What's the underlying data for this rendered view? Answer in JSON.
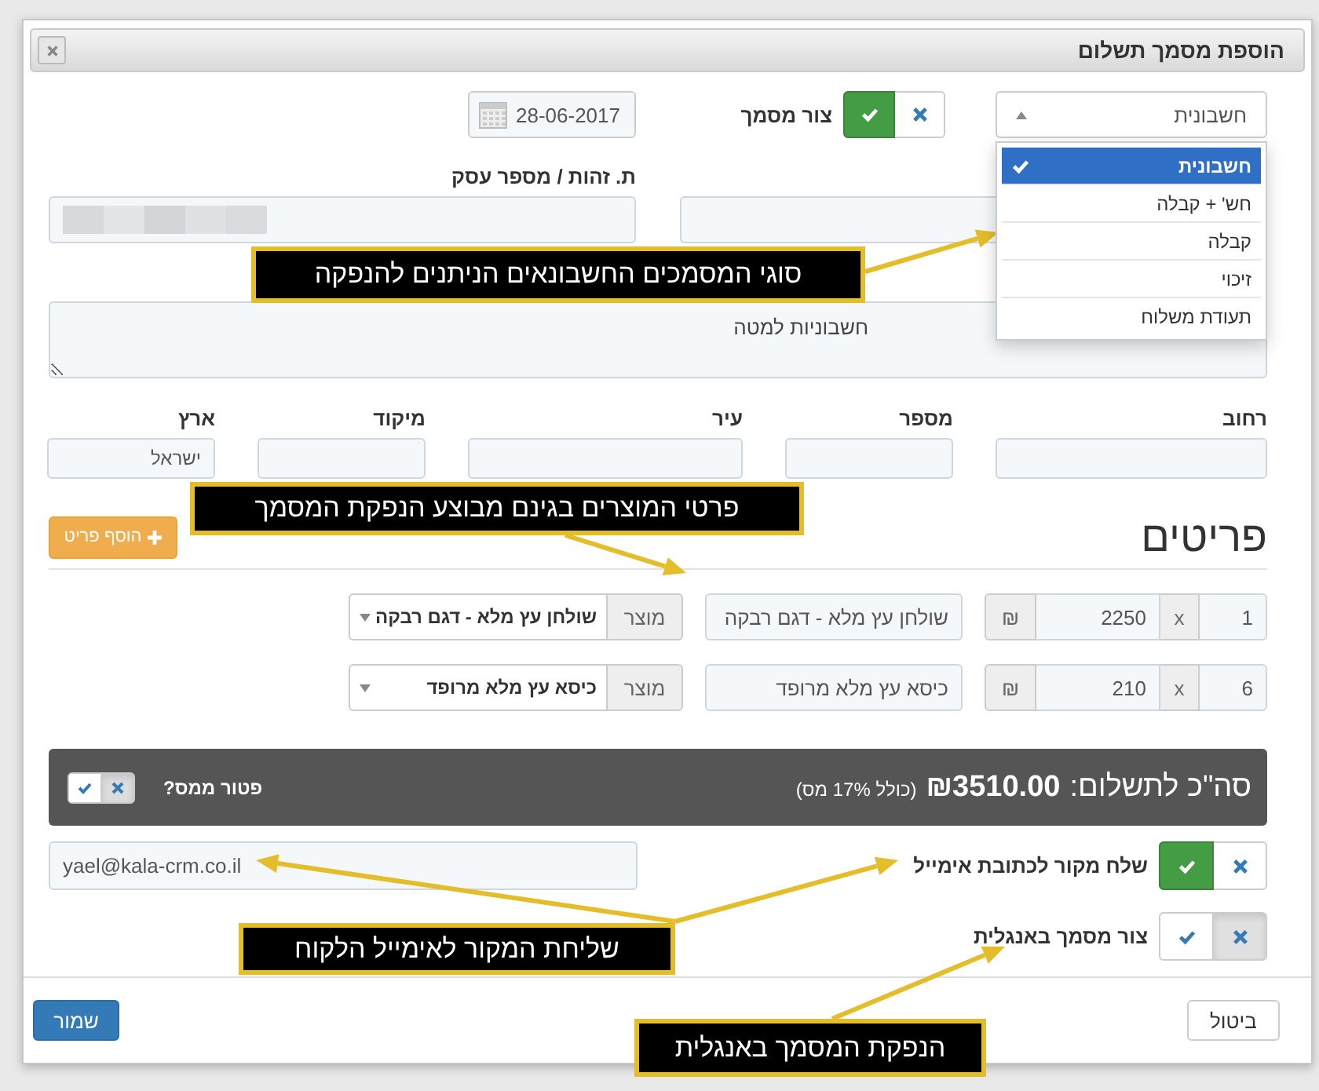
{
  "window": {
    "title": "הוספת מסמך תשלום"
  },
  "document_type": {
    "value": "חשבונית",
    "options": [
      {
        "label": "חשבונית",
        "selected": true
      },
      {
        "label": "חש' + קבלה",
        "selected": false
      },
      {
        "label": "קבלה",
        "selected": false
      },
      {
        "label": "זיכוי",
        "selected": false
      },
      {
        "label": "תעודת משלוח",
        "selected": false
      }
    ]
  },
  "create_document": {
    "label": "צור מסמך",
    "on": true
  },
  "date": {
    "value": "28-06-2017"
  },
  "id_field": {
    "label": "ת. זהות / מספר עסק"
  },
  "notes": {
    "value": "חשבוניות למטה"
  },
  "address": [
    {
      "label": "רחוב"
    },
    {
      "label": "מספר"
    },
    {
      "label": "עיר"
    },
    {
      "label": "מיקוד"
    },
    {
      "label": "ארץ",
      "value": "ישראל"
    }
  ],
  "items": {
    "title": "פריטים",
    "add_button": "הוסף פריט",
    "rows": [
      {
        "quantity": "1",
        "times": "x",
        "price": "2250",
        "currency": "₪",
        "description": "שולחן עץ מלא - דגם רבקה",
        "product_addon": "מוצר",
        "product": "שולחן עץ מלא - דגם רבקה"
      },
      {
        "quantity": "6",
        "times": "x",
        "price": "210",
        "currency": "₪",
        "description": "כיסא עץ מלא מרופד",
        "product_addon": "מוצר",
        "product": "כיסא עץ מלא מרופד"
      }
    ]
  },
  "total": {
    "label": "סה\"כ לתשלום:",
    "amount": "₪3510.00",
    "tax_note": "(כולל 17% מס)",
    "tax_exempt": {
      "label": "פטור ממס?",
      "on": false
    }
  },
  "send_email": {
    "label": "שלח מקור לכתובת אימייל",
    "on": true,
    "email": "yael@kala-crm.co.il"
  },
  "english": {
    "label": "צור מסמך באנגלית",
    "on": false
  },
  "buttons": [
    {
      "label": "ביטול",
      "kind": "default"
    },
    {
      "label": "שמור",
      "kind": "primary"
    }
  ],
  "annotations": [
    {
      "text": "סוגי המסמכים החשבונאים הניתנים להנפקה"
    },
    {
      "text": "פרטי המוצרים בגינם מבוצע הנפקת המסמך"
    },
    {
      "text": "שליחת המקור לאימייל הלקוח"
    },
    {
      "text": "הנפקת המסמך באנגלית"
    }
  ]
}
